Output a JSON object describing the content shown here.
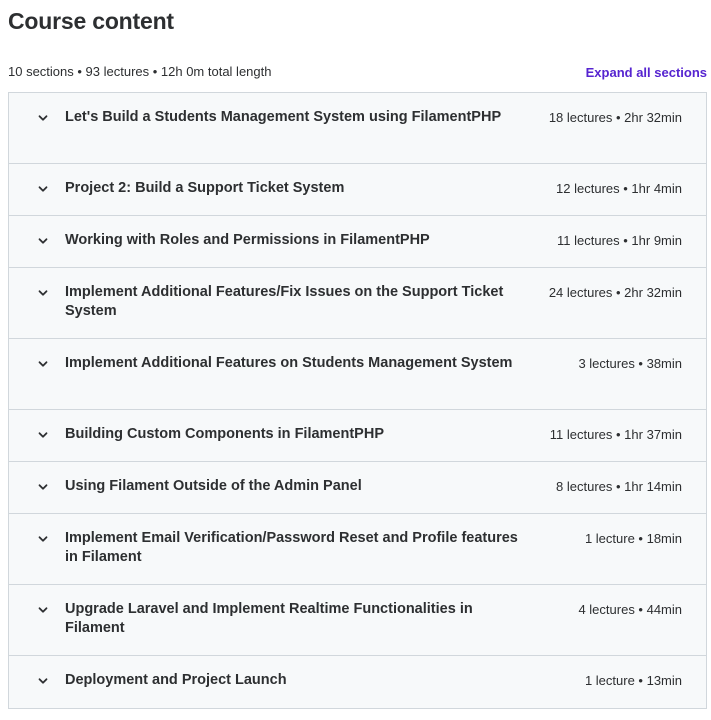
{
  "header": {
    "title": "Course content"
  },
  "summary": {
    "text": "10 sections • 93 lectures • 12h 0m total length",
    "expand_all_label": "Expand all sections"
  },
  "icons": {
    "section_toggle": "chevron-down-icon"
  },
  "colors": {
    "accent": "#5624d0",
    "text": "#2d2f31",
    "section_bg": "#f7f9fa",
    "border": "#d1d7dc"
  },
  "sections": [
    {
      "title": "Let's Build a Students Management System using FilamentPHP",
      "meta": "18 lectures • 2hr 32min"
    },
    {
      "title": "Project 2: Build a Support Ticket System",
      "meta": "12 lectures • 1hr 4min"
    },
    {
      "title": "Working with Roles and Permissions in FilamentPHP",
      "meta": "11 lectures • 1hr 9min"
    },
    {
      "title": "Implement Additional Features/Fix Issues on the Support Ticket System",
      "meta": "24 lectures • 2hr 32min"
    },
    {
      "title": "Implement Additional Features on Students Management System",
      "meta": "3 lectures • 38min"
    },
    {
      "title": "Building Custom Components in FilamentPHP",
      "meta": "11 lectures • 1hr 37min"
    },
    {
      "title": "Using Filament Outside of the Admin Panel",
      "meta": "8 lectures • 1hr 14min"
    },
    {
      "title": "Implement Email Verification/Password Reset and Profile features in Filament",
      "meta": "1 lecture • 18min"
    },
    {
      "title": "Upgrade Laravel and Implement Realtime Functionalities in Filament",
      "meta": "4 lectures • 44min"
    },
    {
      "title": "Deployment and Project Launch",
      "meta": "1 lecture • 13min"
    }
  ]
}
